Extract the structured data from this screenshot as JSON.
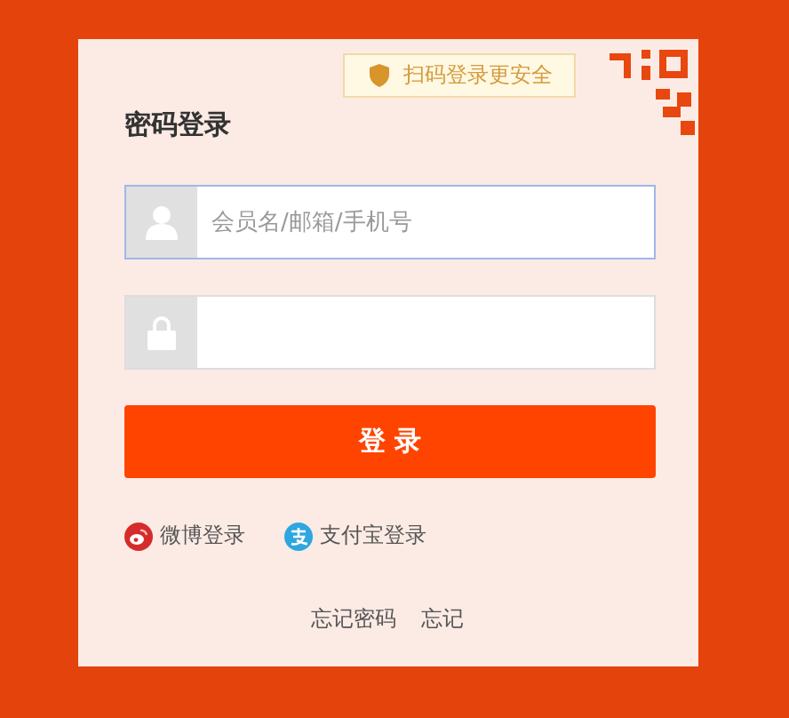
{
  "qr_hint": {
    "label": "扫码登录更安全"
  },
  "title": "密码登录",
  "fields": [
    {
      "kind": "user",
      "placeholder": "会员名/邮箱/手机号",
      "focused": true
    },
    {
      "kind": "password",
      "focused": false
    }
  ],
  "submit": {
    "label": "登 录"
  },
  "social": [
    {
      "kind": "weibo",
      "label": "微博登录"
    },
    {
      "kind": "alipay",
      "label": "支付宝登录"
    }
  ],
  "links": [
    "忘记密码",
    "忘记"
  ]
}
